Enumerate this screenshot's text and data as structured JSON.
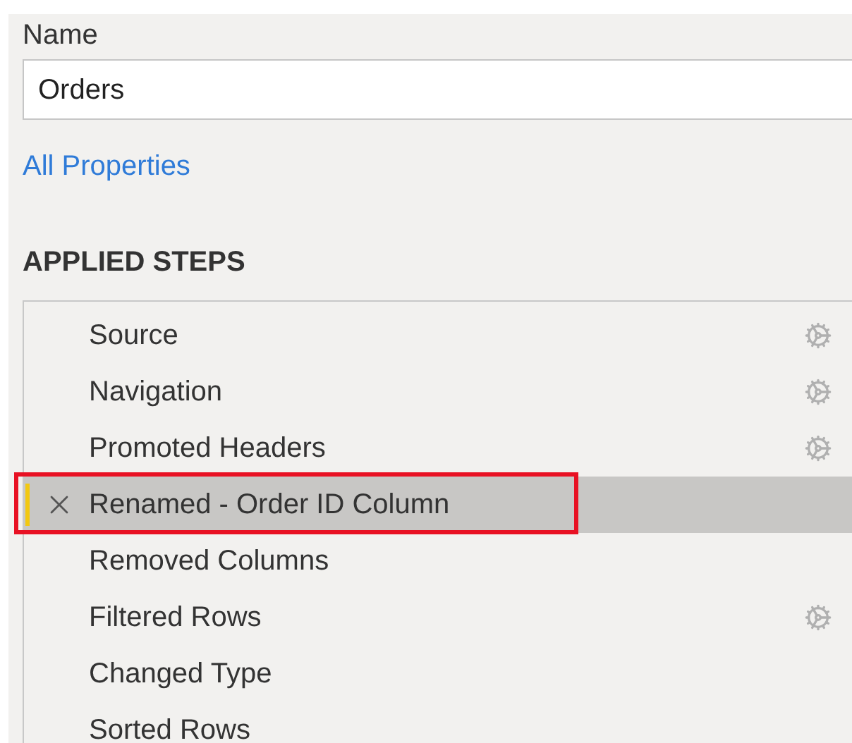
{
  "name_label": "Name",
  "name_field": {
    "value": "Orders"
  },
  "all_properties_link": "All Properties",
  "applied_steps_heading": "APPLIED STEPS",
  "steps": [
    {
      "label": "Source",
      "selected": false,
      "has_settings": true
    },
    {
      "label": "Navigation",
      "selected": false,
      "has_settings": true
    },
    {
      "label": "Promoted Headers",
      "selected": false,
      "has_settings": true
    },
    {
      "label": "Renamed - Order ID Column",
      "selected": true,
      "has_settings": false,
      "highlighted": true
    },
    {
      "label": "Removed Columns",
      "selected": false,
      "has_settings": false
    },
    {
      "label": "Filtered Rows",
      "selected": false,
      "has_settings": true
    },
    {
      "label": "Changed Type",
      "selected": false,
      "has_settings": false
    },
    {
      "label": "Sorted Rows",
      "selected": false,
      "has_settings": false
    }
  ]
}
